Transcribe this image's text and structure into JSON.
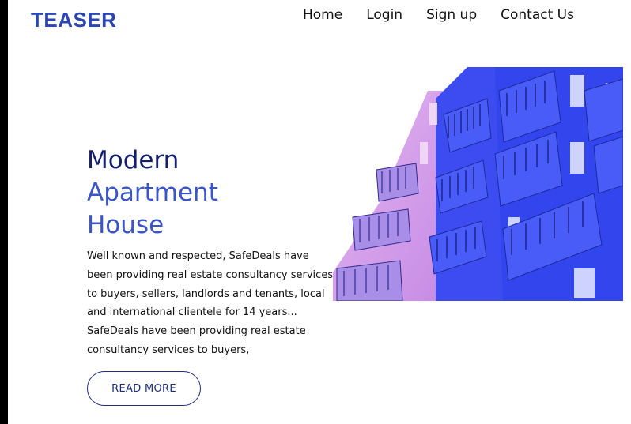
{
  "brand": {
    "logo_text": "TEASER"
  },
  "nav": {
    "items": [
      {
        "label": "Home"
      },
      {
        "label": "Login"
      },
      {
        "label": "Sign up"
      },
      {
        "label": "Contact Us"
      }
    ]
  },
  "hero": {
    "title_line1": "Modern",
    "title_line2": "Apartment",
    "title_line3": "House",
    "paragraph1": "Well known and respected, SafeDeals have been providing real estate consultancy services to buyers, sellers, landlords and tenants, local and international clientele for 14 years...",
    "paragraph2": "SafeDeals have been providing real estate consultancy services to buyers,",
    "button_label": "READ MORE",
    "image_icon": "apartment-building-photo"
  },
  "colors": {
    "brand": "#2a45b4",
    "title_dark": "#14206e",
    "title_accent": "#3a55c9",
    "image_blue": "#3b4ff0",
    "image_pink": "#d79ae8"
  }
}
